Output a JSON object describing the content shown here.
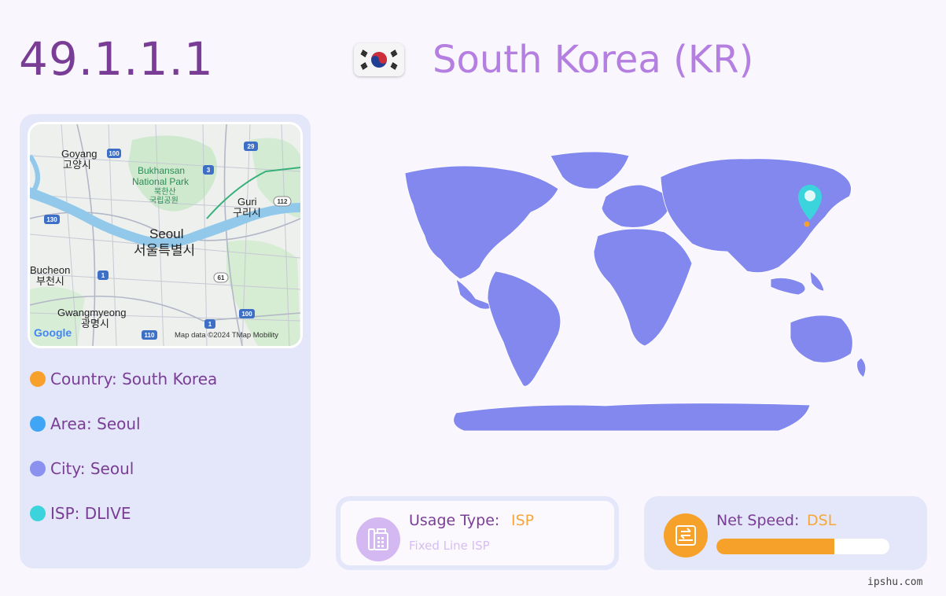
{
  "header": {
    "ip": "49.1.1.1",
    "country_title": "South Korea (KR)"
  },
  "flag": {
    "icon": "south-korea-flag-icon"
  },
  "map": {
    "labels": {
      "goyang_en": "Goyang",
      "goyang_ko": "고양시",
      "bukhansan_en_1": "Bukhansan",
      "bukhansan_en_2": "National Park",
      "bukhansan_ko_1": "북한산",
      "bukhansan_ko_2": "국립공원",
      "guri_en": "Guri",
      "guri_ko": "구리시",
      "seoul_en": "Seoul",
      "seoul_ko": "서울특별시",
      "bucheon_en": "Bucheon",
      "bucheon_ko": "부천시",
      "gwangmyeong_en": "Gwangmyeong",
      "gwangmyeong_ko": "광명시"
    },
    "shields": [
      "100",
      "29",
      "3",
      "112",
      "130",
      "1",
      "61",
      "100",
      "1",
      "110"
    ],
    "logo": "Google",
    "attribution": "Map data ©2024 TMap Mobility"
  },
  "info": [
    {
      "label": "Country: South Korea",
      "color": "#f7a12c"
    },
    {
      "label": "Area: Seoul",
      "color": "#41a5f5"
    },
    {
      "label": "City: Seoul",
      "color": "#8a91ee"
    },
    {
      "label": "ISP: DLIVE",
      "color": "#3cd4dc"
    }
  ],
  "colors": {
    "accent_purple": "#7a3d96",
    "accent_light": "#b47fe0",
    "orange": "#f6a129",
    "map_fill": "#8388ee",
    "marker": "#3cd4dc"
  },
  "usage": {
    "label": "Usage Type:",
    "value": "ISP",
    "sub": "Fixed Line ISP",
    "icon": "fax-phone-icon"
  },
  "speed": {
    "label": "Net Speed:",
    "value": "DSL",
    "progress": 0.68,
    "icon": "transfer-drive-icon"
  },
  "watermark": "ipshu.com"
}
